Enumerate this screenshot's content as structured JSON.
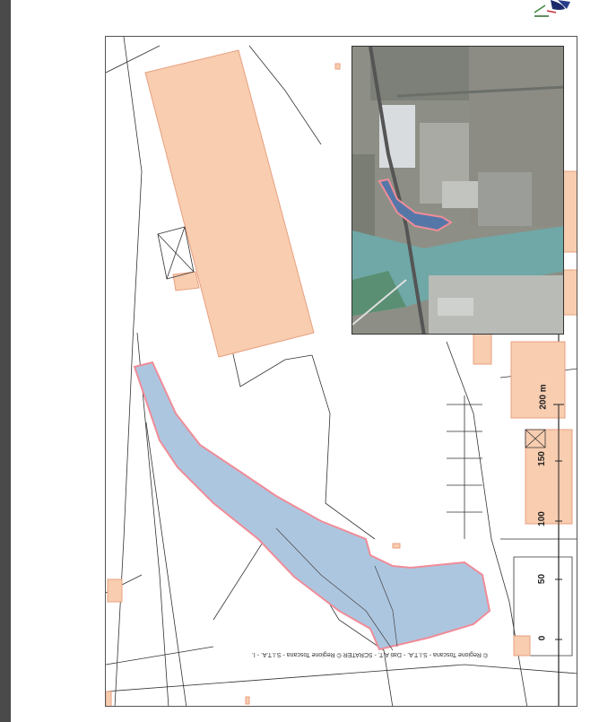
{
  "credit_text": "© Regione Toscana - S.I.T.A. - Dati A.T. - SCRATER © Regione Toscana - S.I.T.A. - I.",
  "scale": {
    "unit_label": "200 m",
    "ticks": [
      "0",
      "50",
      "100",
      "150"
    ]
  },
  "colors": {
    "parcel_fill": "#f8cdb0",
    "parcel_stroke": "#e8a080",
    "highlight_fill": "#adc6e0",
    "highlight_stroke": "#f08c98",
    "water": "#6fa8a6"
  }
}
